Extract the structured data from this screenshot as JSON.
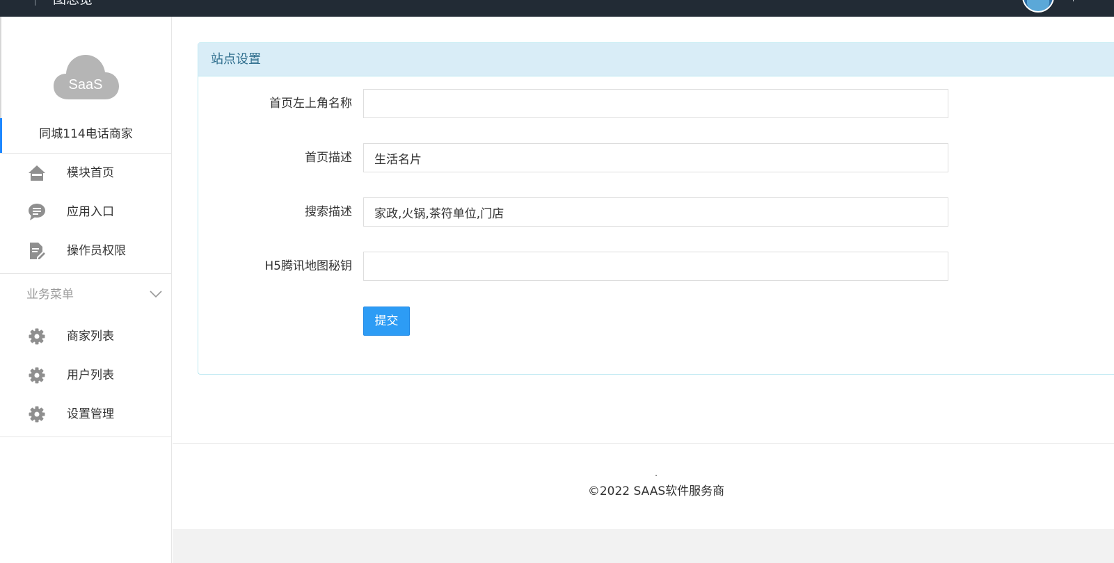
{
  "topbar": {
    "title": "图总览"
  },
  "sidebar": {
    "logo_text": "SaaS",
    "shop_name": "同城114电话商家",
    "items_top": [
      {
        "label": "模块首页",
        "icon": "home-icon"
      },
      {
        "label": "应用入口",
        "icon": "chat-icon"
      },
      {
        "label": "操作员权限",
        "icon": "edit-document-icon"
      }
    ],
    "group": {
      "title": "业务菜单",
      "items": [
        {
          "label": "商家列表",
          "icon": "gear-icon"
        },
        {
          "label": "用户列表",
          "icon": "gear-icon"
        },
        {
          "label": "设置管理",
          "icon": "gear-icon"
        }
      ]
    }
  },
  "panel": {
    "title": "站点设置",
    "fields": [
      {
        "label": "首页左上角名称",
        "value": ""
      },
      {
        "label": "首页描述",
        "value": "生活名片"
      },
      {
        "label": "搜索描述",
        "value": "家政,火锅,茶符单位,门店"
      },
      {
        "label": "H5腾讯地图秘钥",
        "value": ""
      }
    ],
    "submit_label": "提交"
  },
  "footer": {
    "dot": ".",
    "copyright": "©2022 SAAS软件服务商"
  },
  "colors": {
    "topbar": "#222b35",
    "accent": "#2d9cf5",
    "panel_heading_bg": "#d9edf7",
    "panel_heading_text": "#31708f",
    "active_marker": "#1e88ff"
  }
}
